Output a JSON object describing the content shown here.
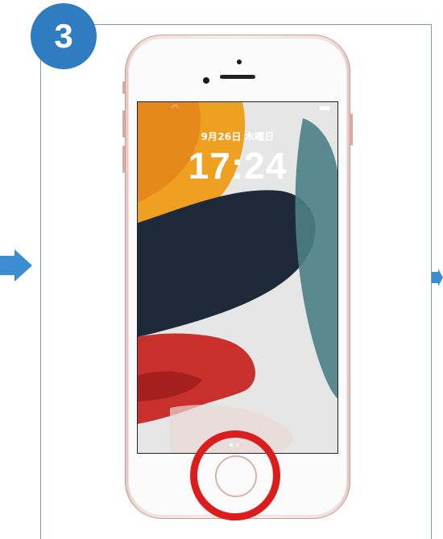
{
  "step": {
    "number": "3"
  },
  "lockscreen": {
    "date": "9月26日 木曜日",
    "time": "17:24"
  },
  "colors": {
    "badge": "#2f7cc1",
    "highlight_ring": "#dc1d1d",
    "phone_body": "#f6dfd9",
    "arrow": "#3d8ed0"
  },
  "icons": {
    "wifi": "wifi-icon",
    "battery": "battery-icon",
    "arrow_prev": "arrow-right-icon",
    "arrow_next": "arrow-right-icon"
  }
}
